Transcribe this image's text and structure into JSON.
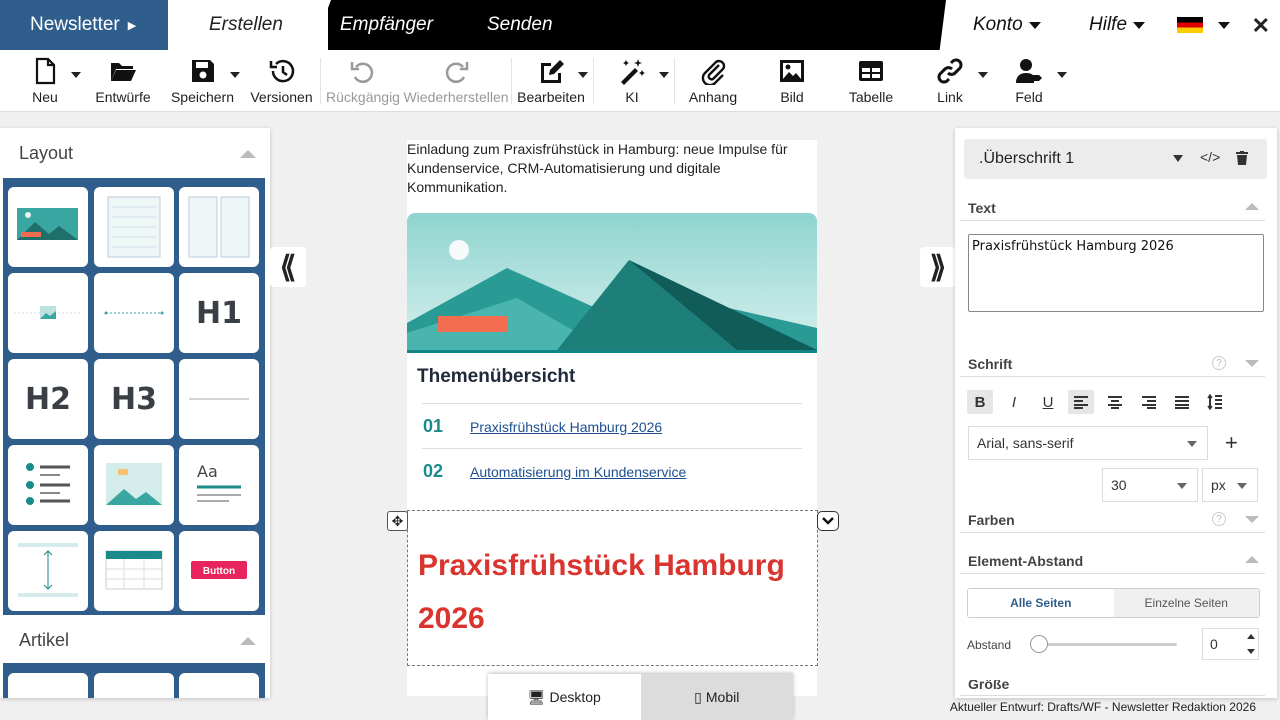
{
  "topbar": {
    "brand": "Newsletter",
    "tabs": [
      "Erstellen",
      "Empfänger",
      "Senden"
    ],
    "konto": "Konto",
    "hilfe": "Hilfe",
    "close": "✕"
  },
  "toolbar": {
    "items": [
      {
        "label": "Neu",
        "icon": "file-icon"
      },
      {
        "label": "Entwürfe",
        "icon": "folder-open-icon"
      },
      {
        "label": "Speichern",
        "icon": "save-icon"
      },
      {
        "label": "Versionen",
        "icon": "history-icon"
      },
      {
        "label": "Rückgängig",
        "icon": "undo-icon"
      },
      {
        "label": "Wiederherstellen",
        "icon": "redo-icon"
      },
      {
        "label": "Bearbeiten",
        "icon": "edit-icon"
      },
      {
        "label": "KI",
        "icon": "magic-wand-icon"
      },
      {
        "label": "Anhang",
        "icon": "paperclip-icon"
      },
      {
        "label": "Bild",
        "icon": "image-icon"
      },
      {
        "label": "Tabelle",
        "icon": "table-icon"
      },
      {
        "label": "Link",
        "icon": "link-icon"
      },
      {
        "label": "Feld",
        "icon": "user-tag-icon"
      }
    ]
  },
  "left_panel": {
    "layout_title": "Layout",
    "artikel_title": "Artikel",
    "tiles": {
      "h1": "H1",
      "h2": "H2",
      "h3": "H3",
      "aa": "Aa",
      "button": "Button"
    }
  },
  "canvas": {
    "intro": "Einladung zum Praxisfrühstück in Hamburg: neue Impulse für Kundenservice, CRM-Automatisierung und digitale Kommunikation.",
    "toc_title": "Themenübersicht",
    "toc": [
      {
        "num": "01",
        "text": "Praxisfrühstück Hamburg 2026"
      },
      {
        "num": "02",
        "text": "Automatisierung im Kundenservice"
      }
    ],
    "headline": "Praxisfrühstück Hamburg 2026"
  },
  "device_toggle": {
    "desktop": "Desktop",
    "mobil": "Mobil"
  },
  "right_panel": {
    "element_select": ".Überschrift 1",
    "text_section": "Text",
    "text_value": "Praxisfrühstück Hamburg 2026",
    "schrift_section": "Schrift",
    "font_family": "Arial, sans-serif",
    "font_size": "30",
    "font_unit": "px",
    "farben_section": "Farben",
    "abstand_section": "Element-Abstand",
    "seg_all": "Alle Seiten",
    "seg_single": "Einzelne Seiten",
    "abstand_label": "Abstand",
    "abstand_value": "0",
    "groesse_section": "Größe",
    "help": "?"
  },
  "status": "Aktueller Entwurf: Drafts/WF - Newsletter Redaktion 2026",
  "colors": {
    "brand_blue": "#2f5d8c",
    "headline_red": "#d9352e",
    "teal": "#1a8a8a"
  }
}
